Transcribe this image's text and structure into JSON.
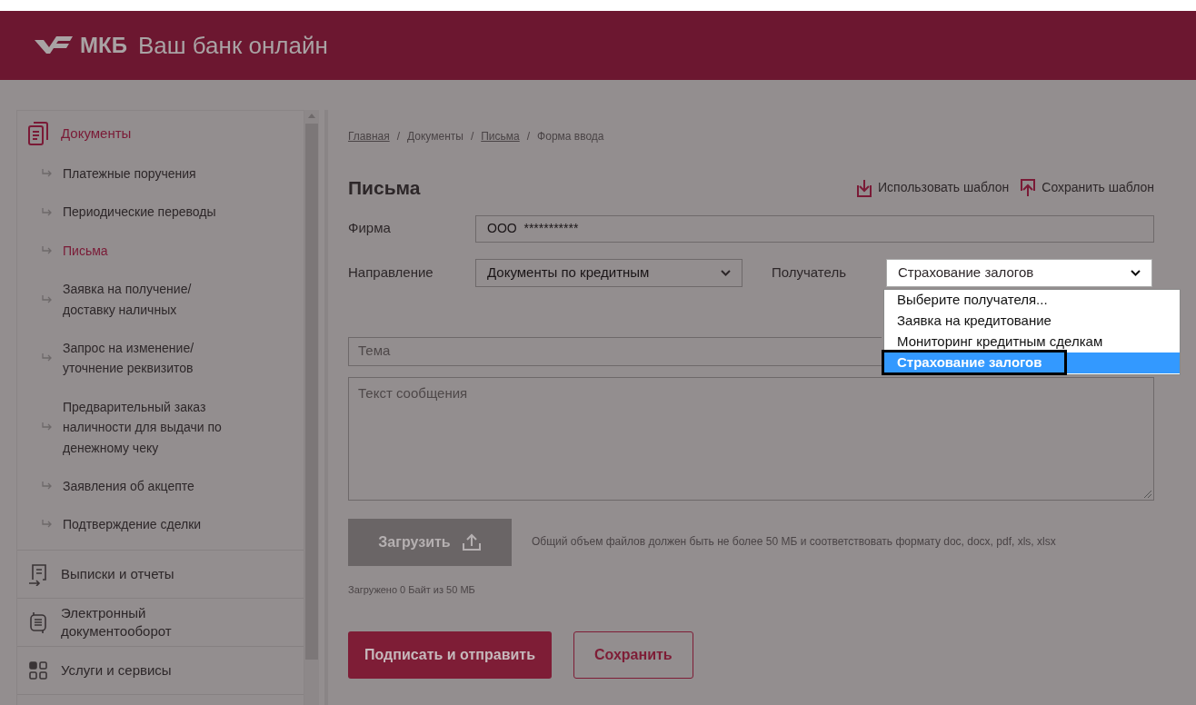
{
  "header": {
    "logo": "МКБ",
    "title": "Ваш банк онлайн"
  },
  "sidebar": {
    "sections": [
      {
        "label": "Документы",
        "kind": "documents",
        "selected": true,
        "children": [
          {
            "label": "Платежные поручения",
            "selected": false
          },
          {
            "label": "Периодические переводы",
            "selected": false
          },
          {
            "label": "Письма",
            "selected": true
          },
          {
            "label": "Заявка на получение/ доставку наличных",
            "selected": false
          },
          {
            "label": "Запрос на изменение/ уточнение реквизитов",
            "selected": false
          },
          {
            "label": "Предварительный заказ наличности для выдачи по денежному чеку",
            "selected": false
          },
          {
            "label": "Заявления об акцепте",
            "selected": false
          },
          {
            "label": "Подтверждение сделки",
            "selected": false
          }
        ]
      },
      {
        "label": "Выписки и отчеты",
        "kind": "statements",
        "selected": false
      },
      {
        "label": "Электронный документооборот",
        "kind": "edo",
        "selected": false
      },
      {
        "label": "Услуги и сервисы",
        "kind": "services",
        "selected": false
      }
    ]
  },
  "breadcrumb": [
    {
      "label": "Главная",
      "kind": "link"
    },
    {
      "label": "/",
      "kind": "separator"
    },
    {
      "label": "Документы",
      "kind": "text"
    },
    {
      "label": "/",
      "kind": "separator"
    },
    {
      "label": "Письма",
      "kind": "link"
    },
    {
      "label": "/",
      "kind": "separator"
    },
    {
      "label": "Форма ввода",
      "kind": "text"
    }
  ],
  "page_title": "Письма",
  "template_actions": [
    {
      "label": "Использовать шаблон",
      "kind": "use"
    },
    {
      "label": "Сохранить шаблон",
      "kind": "save"
    }
  ],
  "form": {
    "firm": {
      "label": "Фирма",
      "value": "ООО  ***********"
    },
    "direction": {
      "label": "Направление",
      "value": "Документы по кредитным"
    },
    "recipient": {
      "label": "Получатель",
      "value": "Страхование залогов",
      "expanded": true,
      "options": [
        {
          "label": "Выберите получателя...",
          "selected": false
        },
        {
          "label": "Заявка на кредитование",
          "selected": false
        },
        {
          "label": "Мониторинг кредитным сделкам",
          "selected": false
        },
        {
          "label": "Страхование залогов",
          "selected": true
        }
      ]
    },
    "subject": {
      "placeholder": "Тема"
    },
    "message": {
      "placeholder": "Текст сообщения"
    }
  },
  "upload": {
    "button": "Загрузить",
    "hint": "Общий объем файлов должен быть не более 50 МБ и соответствовать формату doc, docx, pdf, xls, xlsx",
    "status": "Загружено 0 Байт из 50 МБ"
  },
  "buttons": [
    {
      "label": "Подписать и отправить",
      "kind": "primary"
    },
    {
      "label": "Сохранить",
      "kind": "secondary"
    }
  ]
}
